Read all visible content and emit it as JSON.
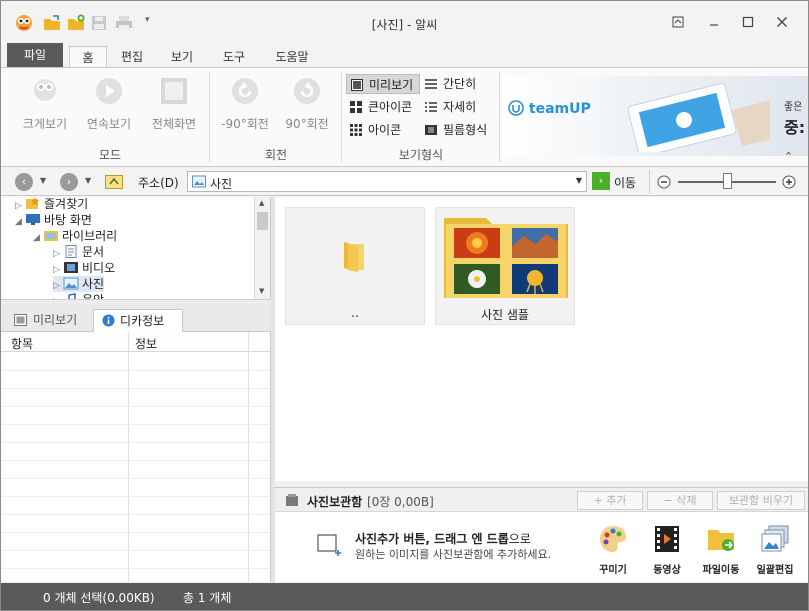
{
  "window": {
    "title": "[사진] - 알씨"
  },
  "ribbon_tabs": [
    "파일",
    "홈",
    "편집",
    "보기",
    "도구",
    "도움말"
  ],
  "ribbon": {
    "mode_buttons": [
      "크게보기",
      "연속보기",
      "전체화면"
    ],
    "mode_group": "모드",
    "rotate_buttons": [
      "-90°회전",
      "90°회전"
    ],
    "rotate_group": "회전",
    "view_options": [
      "미리보기",
      "간단히",
      "큰아이콘",
      "자세히",
      "아이콘",
      "필름형식"
    ],
    "view_group": "보기형식",
    "ad": {
      "logo": "teamUP",
      "line1": "좋은",
      "line2": "중:"
    }
  },
  "address": {
    "label": "주소(D)",
    "value": "사진",
    "go": "이동"
  },
  "tree": {
    "items": [
      "즐겨찾기",
      "바탕 화면",
      "라이브러리",
      "문서",
      "비디오",
      "사진",
      "음악"
    ]
  },
  "info_panel": {
    "tabs": [
      "미리보기",
      "디카정보"
    ],
    "columns": [
      "항목",
      "정보"
    ]
  },
  "main": {
    "tiles": [
      {
        "label": ".."
      },
      {
        "label": "사진 샘플"
      }
    ]
  },
  "photo_box": {
    "title": "사진보관함",
    "count": "[0장 0,00B]",
    "buttons": [
      "+ 추가",
      "− 삭제",
      "보관함 비우기"
    ],
    "message_bold": "사진추가 버튼, 드래그 엔 드롭",
    "message_tail": "으로",
    "message2": "원하는 이미지를 사진보관함에 추가하세요.",
    "tools": [
      "꾸미기",
      "동영상",
      "파일이동",
      "일괄편집"
    ]
  },
  "status": {
    "selected": "0 개체 선택(0.00KB)",
    "total": "총 1 개체"
  },
  "colors": {
    "accent": "#4caf2a",
    "status_bg": "#5a5a5a",
    "folder": "#f5c948"
  }
}
